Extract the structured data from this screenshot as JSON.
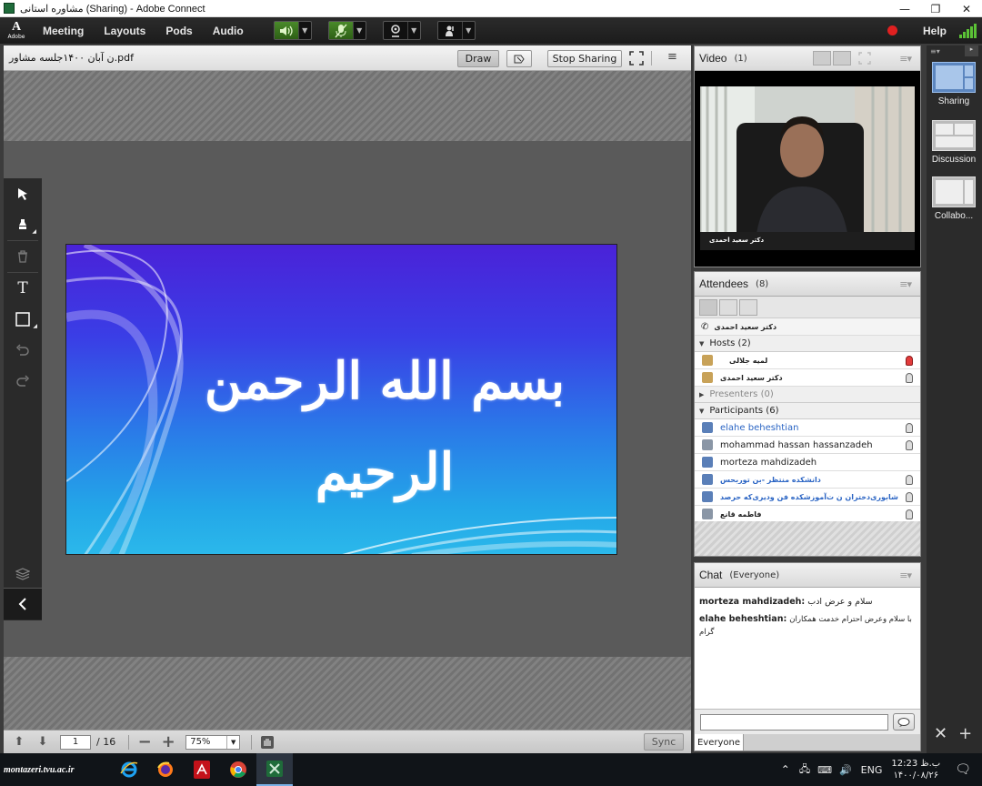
{
  "window": {
    "title": "مشاوره استانی (Sharing) - Adobe Connect",
    "minimize": "—",
    "restore": "❐",
    "close": "✕"
  },
  "menubar": {
    "logo_letter": "A",
    "logo_text": "Adobe",
    "items": [
      "Meeting",
      "Layouts",
      "Pods",
      "Audio"
    ],
    "help": "Help"
  },
  "share_pod": {
    "filename": "ن آبان ۱۴۰۰جلسه مشاور.pdf",
    "draw_label": "Draw",
    "stop_sharing_label": "Stop Sharing",
    "menu_glyph": "≡",
    "footer": {
      "page": "1",
      "total": "/ 16",
      "zoom": "75%",
      "sync_label": "Sync"
    }
  },
  "slide": {
    "text": "بسم الله الرحمن الرحیم"
  },
  "video_pod": {
    "title": "Video",
    "count": "(1)",
    "presenter_label": "دکتر سعید احمدی"
  },
  "attendees_pod": {
    "title": "Attendees",
    "count": "(8)",
    "speaker_row": "دکتر سعید احمدی",
    "hosts_label": "Hosts (2)",
    "hosts": [
      "لمیه جلالی",
      "دکتر سعید احمدی"
    ],
    "presenters_label": "Presenters (0)",
    "participants_label": "Participants (6)",
    "participants": [
      {
        "name": "elahe beheshtian",
        "style": "blue"
      },
      {
        "name": "mohammad hassan hassanzadeh",
        "style": "normal"
      },
      {
        "name": "morteza mahdizadeh",
        "style": "normal"
      },
      {
        "name": "دانشکده منتظر -بن توربحس",
        "style": "blue"
      },
      {
        "name": "شابوری‌دختران ن ت‌آموزشکده فن ودیری‌که حرصد",
        "style": "blue"
      },
      {
        "name": "فاطمه قانع",
        "style": "normal"
      }
    ]
  },
  "chat_pod": {
    "title": "Chat",
    "scope": "(Everyone)",
    "messages": [
      {
        "sender": "morteza mahdizadeh:",
        "text": "سلام و عرض ادب"
      },
      {
        "sender": "elahe beheshtian:",
        "text": "با سلام وعرض احترام خدمت همکاران گرام"
      }
    ],
    "tab": "Everyone"
  },
  "layouts": [
    "Sharing",
    "Discussion",
    "Collabo..."
  ],
  "taskbar": {
    "brand": "montazeri.tvu.ac.ir",
    "lang": "ENG",
    "time": "12:23 ب.ظ",
    "date": "۱۴۰۰/۰۸/۲۶"
  },
  "colors": {
    "accent": "#5c86bf",
    "record": "#e02020",
    "signal": "#5bc236",
    "link": "#2b65c4"
  }
}
